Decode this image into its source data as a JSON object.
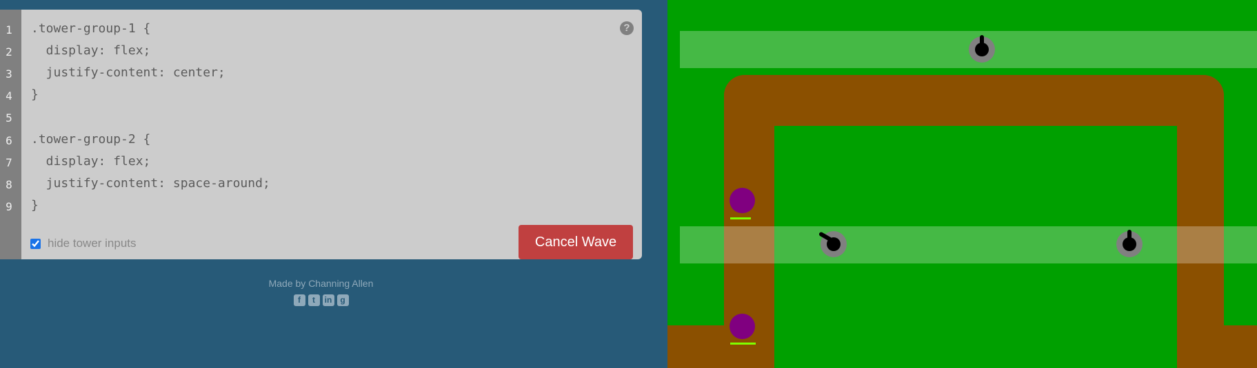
{
  "editor": {
    "line_numbers": [
      "1",
      "2",
      "3",
      "4",
      "5",
      "6",
      "7",
      "8",
      "9"
    ],
    "lines": [
      ".tower-group-1 {",
      "  display: flex;",
      "  justify-content: center;",
      "}",
      "",
      ".tower-group-2 {",
      "  display: flex;",
      "  justify-content: space-around;",
      "}"
    ],
    "help_icon": "question-icon",
    "hide_inputs_label": "hide tower inputs",
    "hide_inputs_checked": true,
    "cancel_button": "Cancel Wave"
  },
  "footer": {
    "credit": "Made by Channing Allen",
    "social_icons": [
      "facebook-icon",
      "twitter-icon",
      "linkedin-icon",
      "github-icon"
    ]
  },
  "game": {
    "colors": {
      "grass": "#00a000",
      "road": "#8b5000",
      "tower": "#808080",
      "enemy": "#800080",
      "health": "#7fff00"
    },
    "tower_groups": [
      {
        "name": "tower-group-1",
        "towers": 1
      },
      {
        "name": "tower-group-2",
        "towers": 2
      }
    ],
    "enemies": 2
  }
}
